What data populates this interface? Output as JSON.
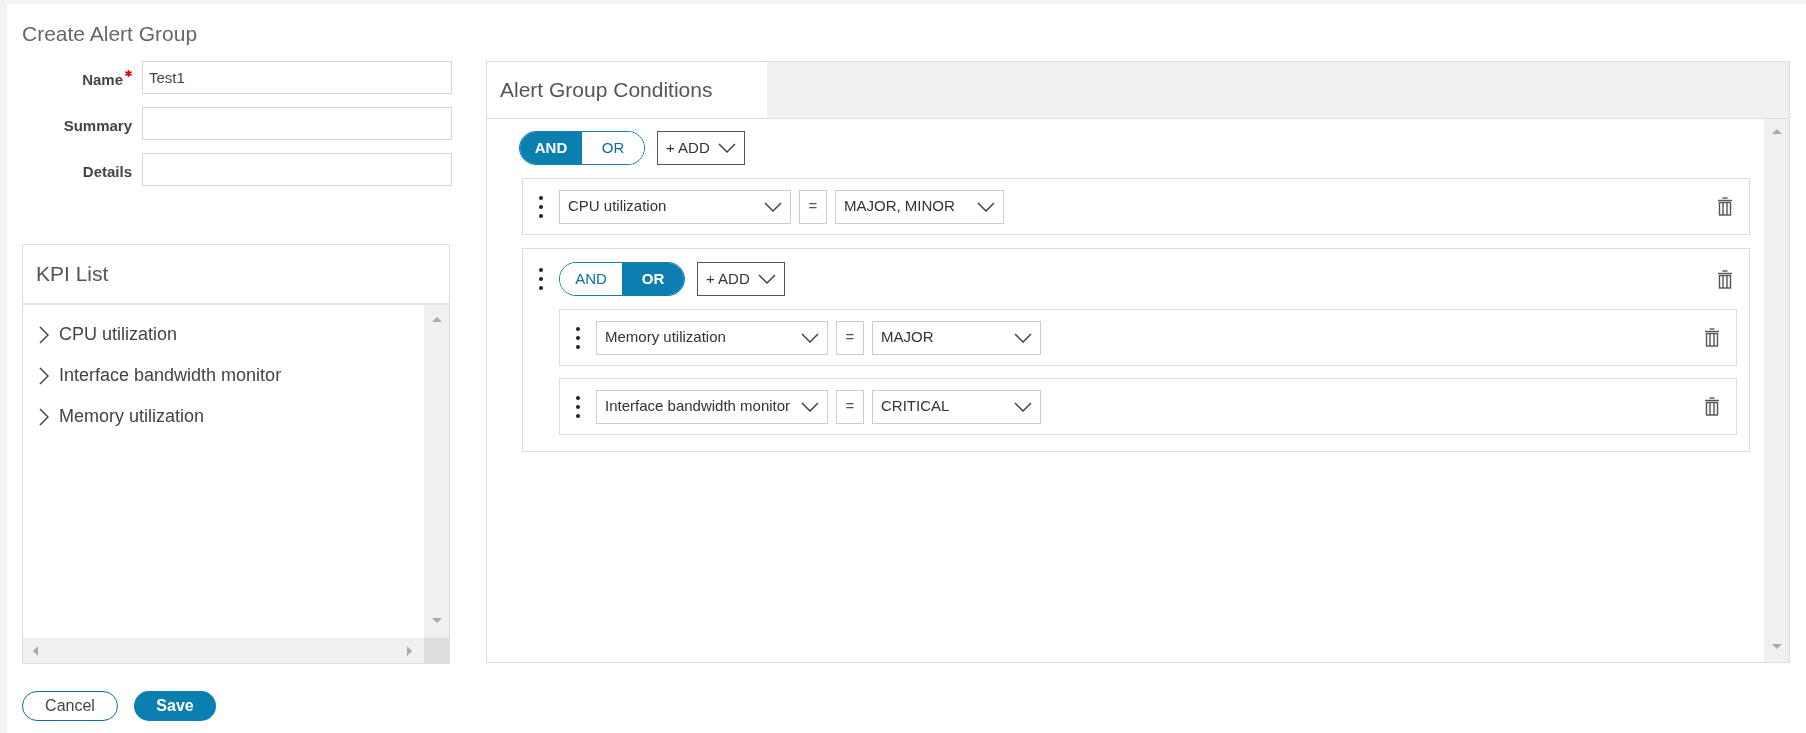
{
  "title": "Create Alert Group",
  "form": [
    {
      "label": "Name",
      "required": true,
      "value": "Test1"
    },
    {
      "label": "Summary"
    },
    {
      "label": "Details"
    }
  ],
  "kpi_list": {
    "title": "KPI List",
    "items": [
      {
        "label": "CPU utilization",
        "expanded": false
      },
      {
        "label": "Interface bandwidth monitor",
        "expanded": false
      },
      {
        "label": "Memory utilization",
        "expanded": false
      }
    ]
  },
  "conditions": {
    "tab": "Alert Group Conditions",
    "toggle": [
      {
        "label": "AND",
        "selected": true
      },
      {
        "label": "OR",
        "selected": false
      }
    ],
    "add_button": "+ ADD",
    "items": [
      {
        "kind": "rule",
        "kpi": "CPU utilization",
        "operator": "=",
        "value": "MAJOR, MINOR"
      },
      {
        "kind": "group",
        "toggle": [
          {
            "label": "AND",
            "selected": false
          },
          {
            "label": "OR",
            "selected": true
          }
        ],
        "add_button": "+ ADD",
        "children": [
          {
            "kind": "rule",
            "kpi": "Memory utilization",
            "operator": "=",
            "value": "MAJOR"
          },
          {
            "kind": "rule",
            "kpi": "Interface bandwidth monitor",
            "operator": "=",
            "value": "CRITICAL"
          }
        ]
      }
    ]
  },
  "buttons": [
    {
      "kind": "secondary",
      "label": "Cancel"
    },
    {
      "kind": "primary",
      "label": "Save"
    }
  ]
}
